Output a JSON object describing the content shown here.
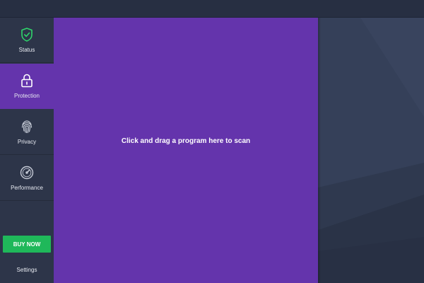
{
  "sidebar": {
    "items": [
      {
        "label": "Status",
        "icon": "shield-check-icon",
        "active": false
      },
      {
        "label": "Protection",
        "icon": "lock-icon",
        "active": true
      },
      {
        "label": "Privacy",
        "icon": "fingerprint-icon",
        "active": false
      },
      {
        "label": "Performance",
        "icon": "speedometer-icon",
        "active": false
      }
    ],
    "buy_label": "BUY NOW",
    "settings_label": "Settings"
  },
  "main": {
    "drop_text": "Click and drag a program here to scan"
  },
  "colors": {
    "accent": "#6434ac",
    "buy": "#1fb85a",
    "status_icon": "#2fd66b",
    "sidebar_bg": "#2d3549",
    "right_panel_bg": "#354059"
  }
}
